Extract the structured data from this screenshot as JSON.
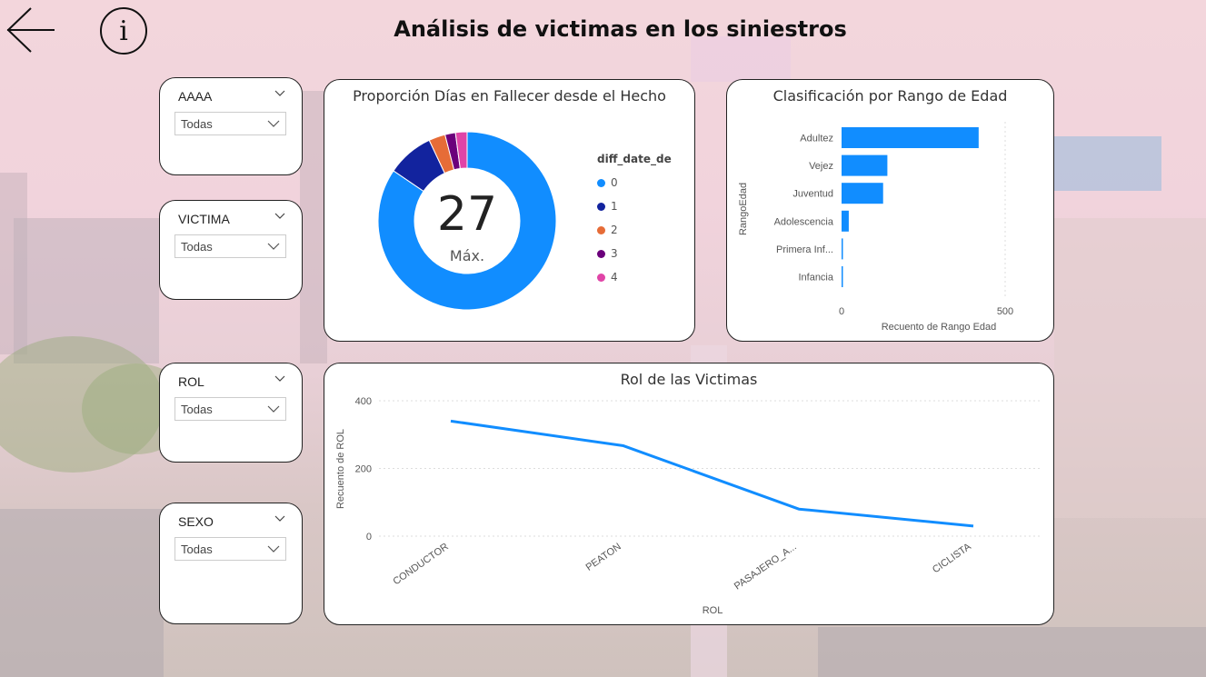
{
  "header": {
    "title": "Análisis de victimas en los siniestros"
  },
  "nav": {
    "back_icon": "arrow-left-icon",
    "info_icon": "info-icon",
    "info_glyph": "i"
  },
  "slicers": [
    {
      "title": "AAAA",
      "value": "Todas"
    },
    {
      "title": "VICTIMA",
      "value": "Todas"
    },
    {
      "title": "ROL",
      "value": "Todas"
    },
    {
      "title": "SEXO",
      "value": "Todas"
    }
  ],
  "donut": {
    "title": "Proporción Días en Fallecer desde el Hecho",
    "center_value": "27",
    "center_label": "Máx.",
    "legend_title": "diff_date_de",
    "legend": [
      {
        "label": "0",
        "color": "#118DFF"
      },
      {
        "label": "1",
        "color": "#12239E"
      },
      {
        "label": "2",
        "color": "#E66C37"
      },
      {
        "label": "3",
        "color": "#6B007B"
      },
      {
        "label": "4",
        "color": "#E044A7"
      }
    ]
  },
  "chart_data": [
    {
      "type": "pie",
      "title": "Proporción Días en Fallecer desde el Hecho",
      "categories": [
        "0",
        "1",
        "2",
        "3",
        "4"
      ],
      "values": [
        84.5,
        8.5,
        3.0,
        1.9,
        2.1
      ],
      "colors": [
        "#118DFF",
        "#12239E",
        "#E66C37",
        "#6B007B",
        "#E044A7"
      ]
    },
    {
      "type": "bar",
      "orientation": "horizontal",
      "title": "Clasificación por Rango de Edad",
      "categories": [
        "Adultez",
        "Vejez",
        "Juventud",
        "Adolescencia",
        "Primera Inf...",
        "Infancia"
      ],
      "values": [
        419,
        140,
        127,
        22,
        4,
        3
      ],
      "xlabel": "Recuento de Rango Edad",
      "ylabel": "RangoEdad",
      "xlim": [
        0,
        500
      ],
      "xticks": [
        "0",
        "500"
      ],
      "color": "#118DFF"
    },
    {
      "type": "line",
      "title": "Rol de las Victimas",
      "categories": [
        "CONDUCTOR",
        "PEATON",
        "PASAJERO_A...",
        "CICLISTA"
      ],
      "values": [
        340,
        267,
        80,
        30
      ],
      "xlabel": "ROL",
      "ylabel": "Recuento de ROL",
      "ylim": [
        0,
        400
      ],
      "yticks": [
        "0",
        "200",
        "400"
      ],
      "color": "#118DFF"
    }
  ]
}
